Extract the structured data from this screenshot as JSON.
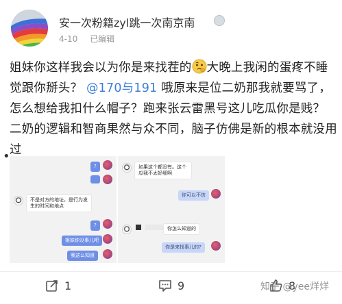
{
  "post": {
    "username": "安一次粉籍zyl跳一次南京南",
    "date": "4-10",
    "edited": "已编辑",
    "text_parts": {
      "p1": "姐妹你这样我会以为你是来找茬的",
      "p2": "大晚上我闲的蛋疼不睡觉跟你掰头？ ",
      "mention": "@170与191",
      "p3": " 哦原来是位二奶那我就要骂了，怎么想给我扣什么帽子？跑来张云雷黑号这儿吃瓜你是贱？ 二奶的逻辑和智商果然与众不同，脑子仿佛是新的根本就没用过"
    },
    "emoji_icon": "thinking-face-icon"
  },
  "images": {
    "left": {
      "bubbles": [
        {
          "text": "?",
          "side": "me"
        },
        {
          "text": "不是对方的地址，是行为发生的时间和地点",
          "side": "them"
        },
        {
          "text": "?",
          "side": "me"
        },
        {
          "text": "姐妹你没事儿吧",
          "side": "me"
        },
        {
          "text": "我这么知道",
          "side": "me"
        }
      ]
    },
    "right": {
      "bubbles": [
        {
          "text": "如果这个都没有。这个瓜我不太好细啊",
          "side": "them"
        },
        {
          "text": "你可以不信",
          "side": "me-light"
        },
        {
          "text": "你怎么知道的",
          "side": "them"
        },
        {
          "text": "你是来找事儿的?",
          "side": "me-light"
        }
      ]
    }
  },
  "footer": {
    "repost_count": "1",
    "comment_count": "9",
    "like_count": "8",
    "watermark": "知乎 @yee烊烊"
  },
  "colors": {
    "mention": "#3b7dd8",
    "bubble_me": "#6f8fe6",
    "meta": "#999999"
  }
}
